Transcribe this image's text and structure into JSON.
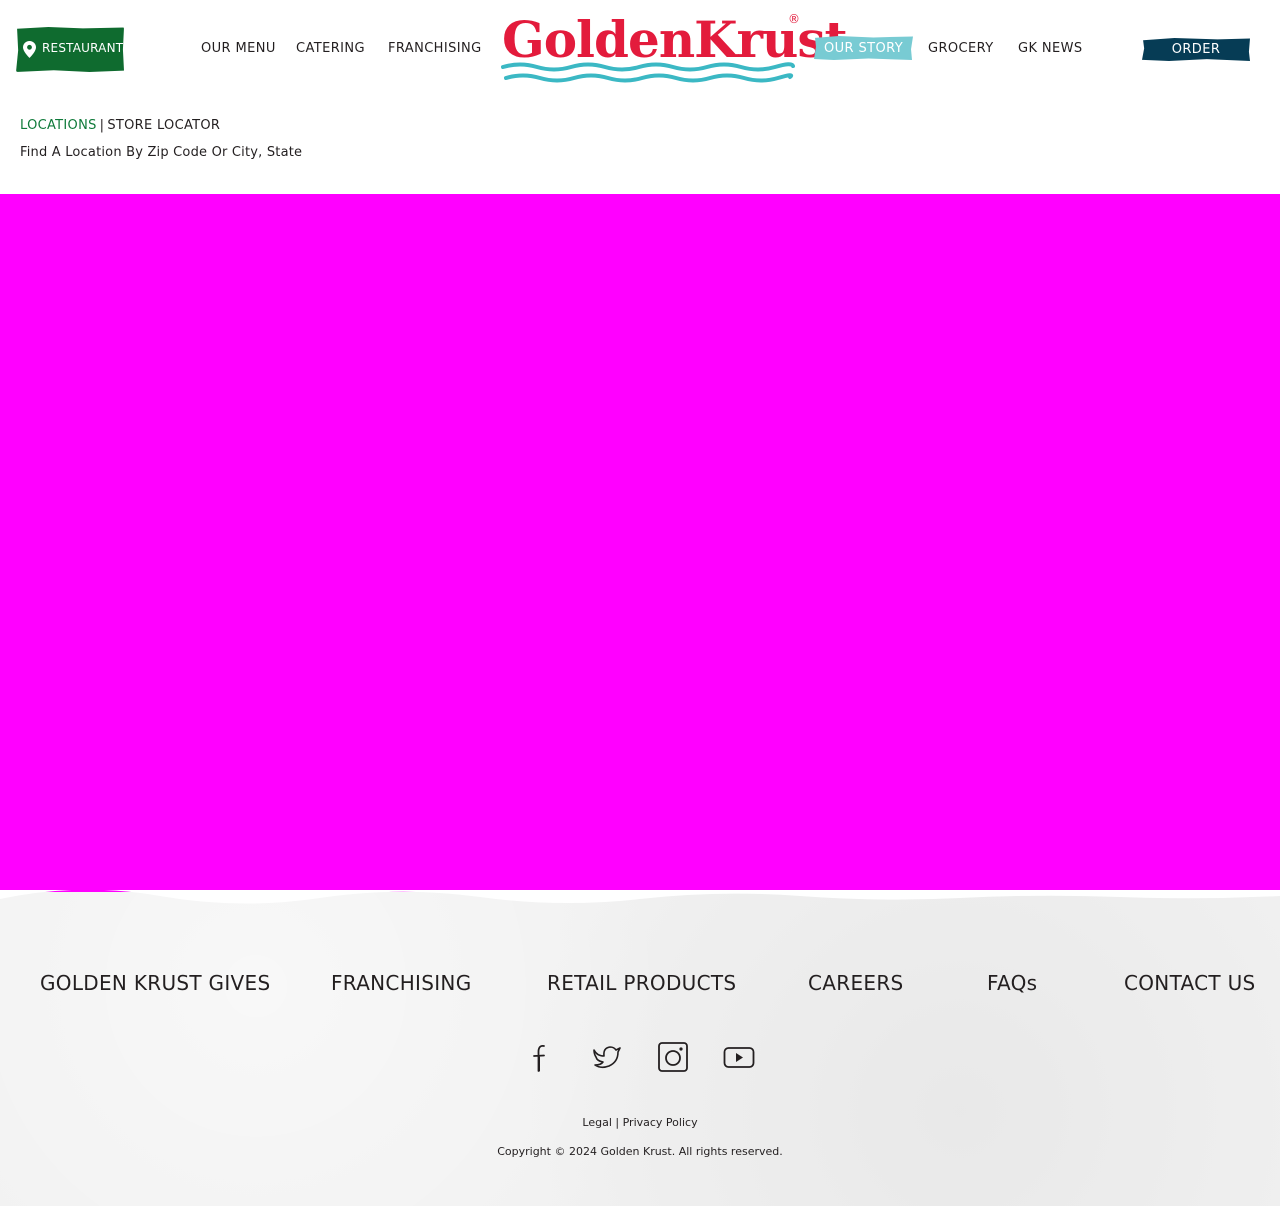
{
  "header": {
    "restaurant_label": "RESTAURANT",
    "nav_left": [
      "OUR MENU",
      "CATERING",
      "FRANCHISING"
    ],
    "nav_right": [
      "OUR STORY",
      "GROCERY",
      "GK NEWS"
    ],
    "active_nav": "OUR STORY",
    "order_label": "ORDER",
    "logo_text": "GoldenKrust",
    "logo_registered": "®"
  },
  "breadcrumb": {
    "link": "LOCATIONS",
    "separator": "|",
    "current": "STORE LOCATOR"
  },
  "subtitle": "Find A Location By Zip Code Or City, State",
  "footer": {
    "links": [
      "GOLDEN KRUST GIVES",
      "FRANCHISING",
      "RETAIL PRODUCTS",
      "CAREERS",
      "FAQs",
      "CONTACT US"
    ],
    "social": [
      "facebook-icon",
      "twitter-icon",
      "instagram-icon",
      "youtube-icon"
    ],
    "legal": "Legal",
    "legal_sep": "|",
    "privacy": "Privacy Policy",
    "copyright": "Copyright © 2024 Golden Krust. All rights reserved."
  },
  "colors": {
    "brand_red": "#e31b3c",
    "brand_teal": "#3bb8c4",
    "restaurant_green": "#0f6b2f",
    "active_tab": "#78cbd3",
    "order_navy": "#063c55",
    "map_placeholder": "#ff00ff"
  }
}
